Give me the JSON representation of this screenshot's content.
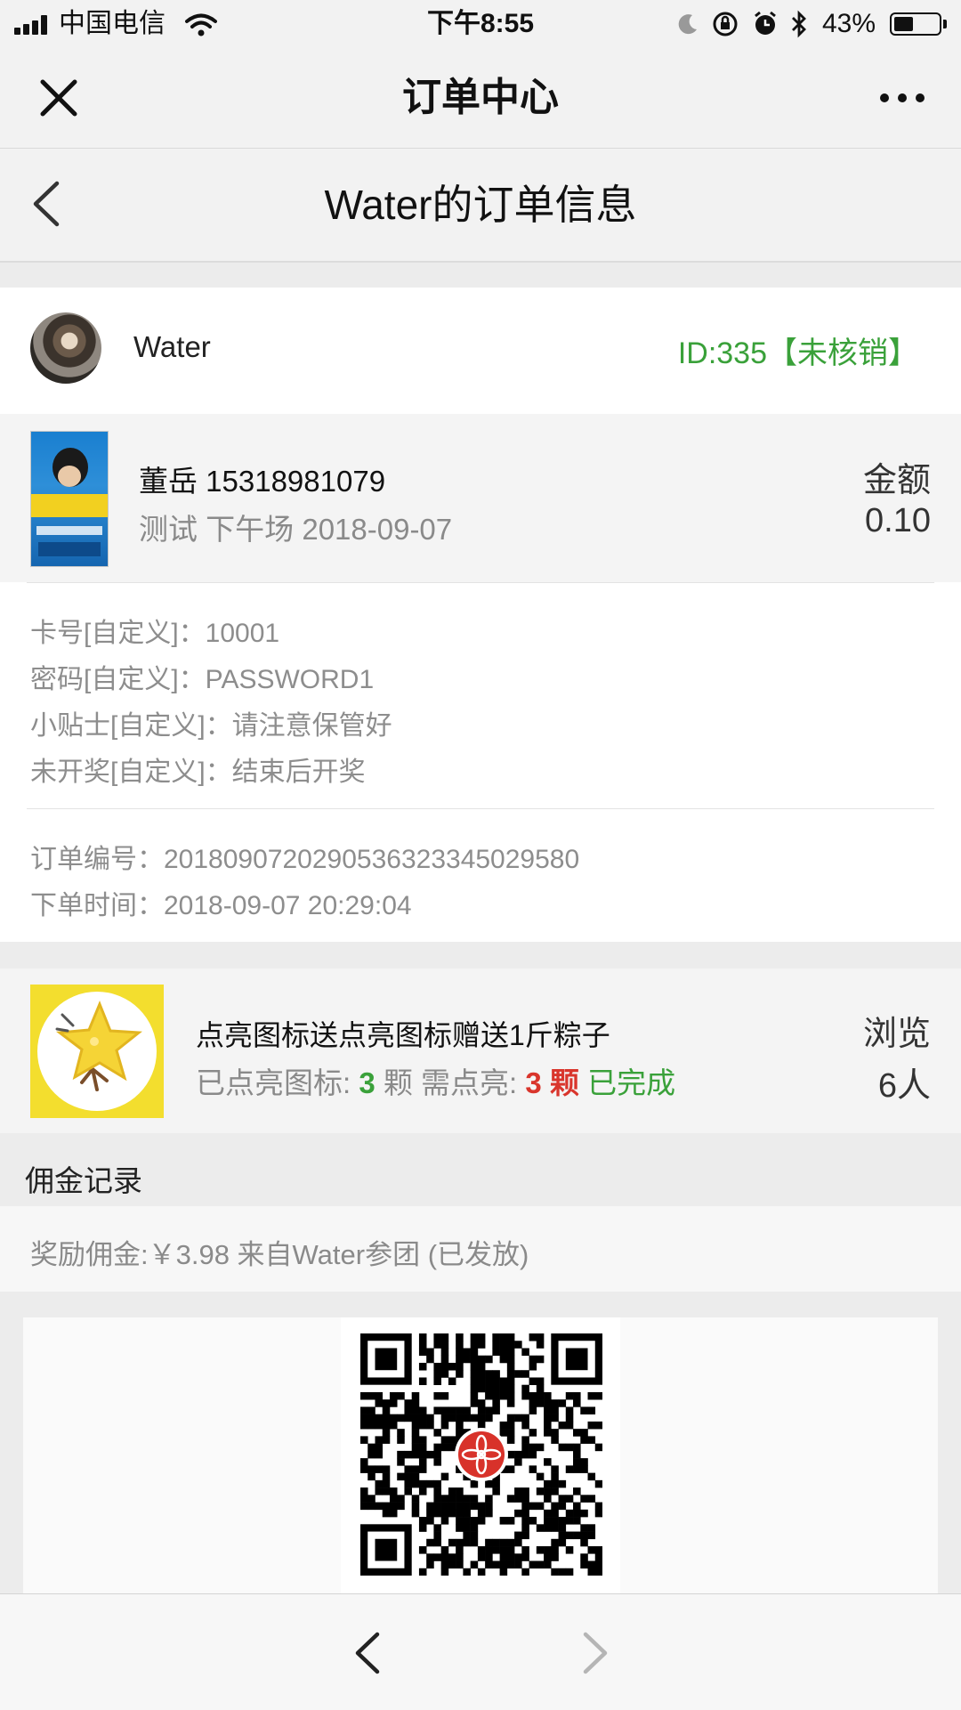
{
  "status_bar": {
    "carrier": "中国电信",
    "time": "下午8:55",
    "battery": "43%",
    "battery_level": 0.43
  },
  "nav": {
    "title": "订单中心"
  },
  "sub_header": {
    "title": "Water的订单信息"
  },
  "user": {
    "name": "Water",
    "order_id_status": "ID:335【未核销】"
  },
  "product": {
    "name_phone": "董岳 15318981079",
    "subtitle": "测试 下午场 2018-09-07",
    "amount_label": "金额",
    "amount_value": "0.10"
  },
  "details": {
    "card_no": "卡号[自定义]：10001",
    "password": "密码[自定义]：PASSWORD1",
    "tip": "小贴士[自定义]：请注意保管好",
    "lottery": "未开奖[自定义]：结束后开奖",
    "order_no": "订单编号：201809072029053632334502958​0",
    "order_time": "下单时间：2018-09-07 20:29:04"
  },
  "promo": {
    "title": "点亮图标送点亮图标赠送1斤粽子",
    "lit_label": "已点亮图标: ",
    "lit_count": "3",
    "lit_unit": " 颗 需点亮: ",
    "need_count": "3",
    "need_unit": " 颗",
    "status": " 已完成",
    "browse_label": "浏览",
    "browse_value": "6人"
  },
  "commission": {
    "title": "佣金记录",
    "record": "奖励佣金:￥3.98 来自Water参团 (已发放)"
  },
  "colors": {
    "green": "#3aa13a",
    "red": "#d9352c"
  },
  "icons": [
    "close-icon",
    "more-icon",
    "back-chevron-icon",
    "moon-icon",
    "orientation-lock-icon",
    "alarm-icon",
    "bluetooth-icon",
    "wifi-icon",
    "battery-icon",
    "nav-back-icon",
    "nav-forward-icon"
  ]
}
